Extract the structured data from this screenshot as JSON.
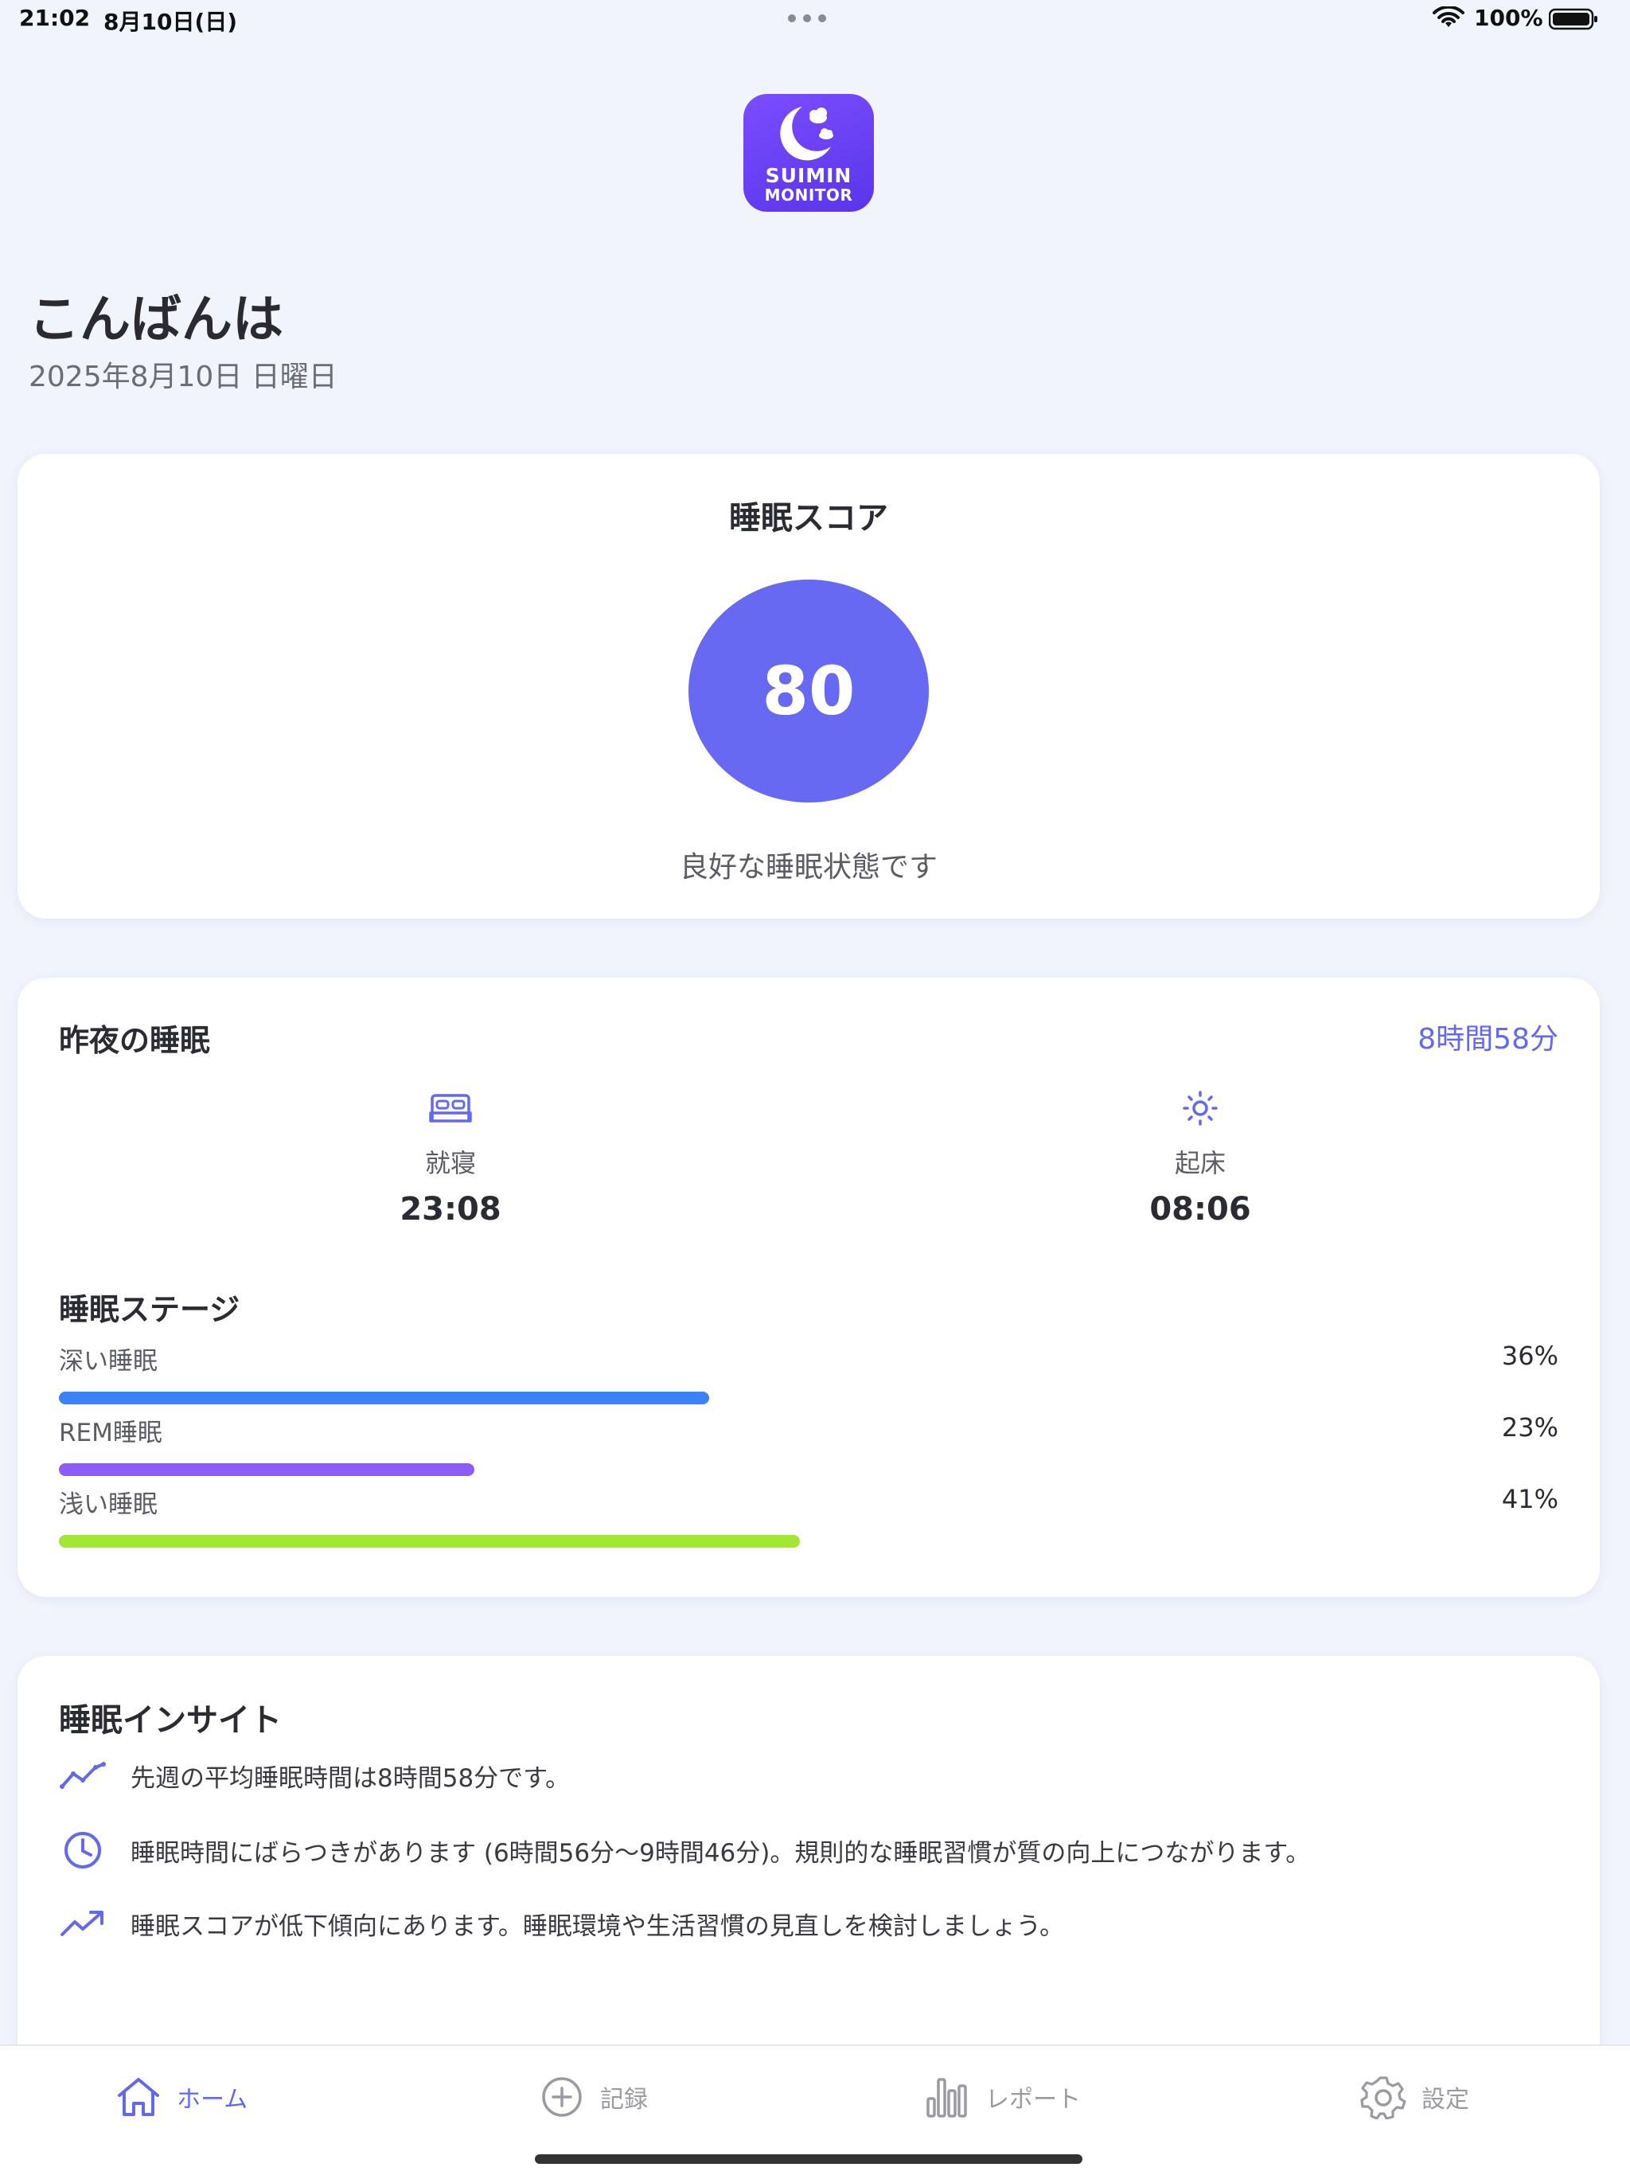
{
  "status_bar": {
    "time": "21:02",
    "date": "8月10日(日)",
    "battery_pct": "100%"
  },
  "logo": {
    "line1": "SUIMIN",
    "line2": "MONITOR"
  },
  "greeting": {
    "title": "こんばんは",
    "date": "2025年8月10日 日曜日"
  },
  "score_card": {
    "title": "睡眠スコア",
    "score": "80",
    "status": "良好な睡眠状態です",
    "color": "#6769f2"
  },
  "sleep_card": {
    "title": "昨夜の睡眠",
    "total": "8時間58分",
    "bedtime": {
      "label": "就寝",
      "value": "23:08",
      "icon": "bed-icon"
    },
    "wake": {
      "label": "起床",
      "value": "08:06",
      "icon": "sun-icon"
    },
    "stages_title": "睡眠ステージ",
    "stages": [
      {
        "name": "深い睡眠",
        "pct": "36%",
        "fraction": 0.36,
        "color": "#3b82f6"
      },
      {
        "name": "REM睡眠",
        "pct": "23%",
        "fraction": 0.23,
        "color": "#8b5cf6"
      },
      {
        "name": "浅い睡眠",
        "pct": "41%",
        "fraction": 0.41,
        "color": "#a3e635"
      }
    ]
  },
  "insight_card": {
    "title": "睡眠インサイト",
    "items": [
      {
        "icon": "trend-line-icon",
        "text": "先週の平均睡眠時間は8時間58分です。"
      },
      {
        "icon": "clock-icon",
        "text": "睡眠時間にばらつきがあります (6時間56分～9時間46分)。規則的な睡眠習慣が質の向上につながります。"
      },
      {
        "icon": "trend-up-icon",
        "text": "睡眠スコアが低下傾向にあります。睡眠環境や生活習慣の見直しを検討しましょう。"
      }
    ]
  },
  "tab_bar": {
    "tabs": [
      {
        "label": "ホーム",
        "icon": "home-icon",
        "active": true
      },
      {
        "label": "記録",
        "icon": "plus-circle-icon",
        "active": false
      },
      {
        "label": "レポート",
        "icon": "bar-chart-icon",
        "active": false
      },
      {
        "label": "設定",
        "icon": "gear-icon",
        "active": false
      }
    ]
  },
  "colors": {
    "accent": "#6369ee",
    "background": "#f1f4fd"
  }
}
